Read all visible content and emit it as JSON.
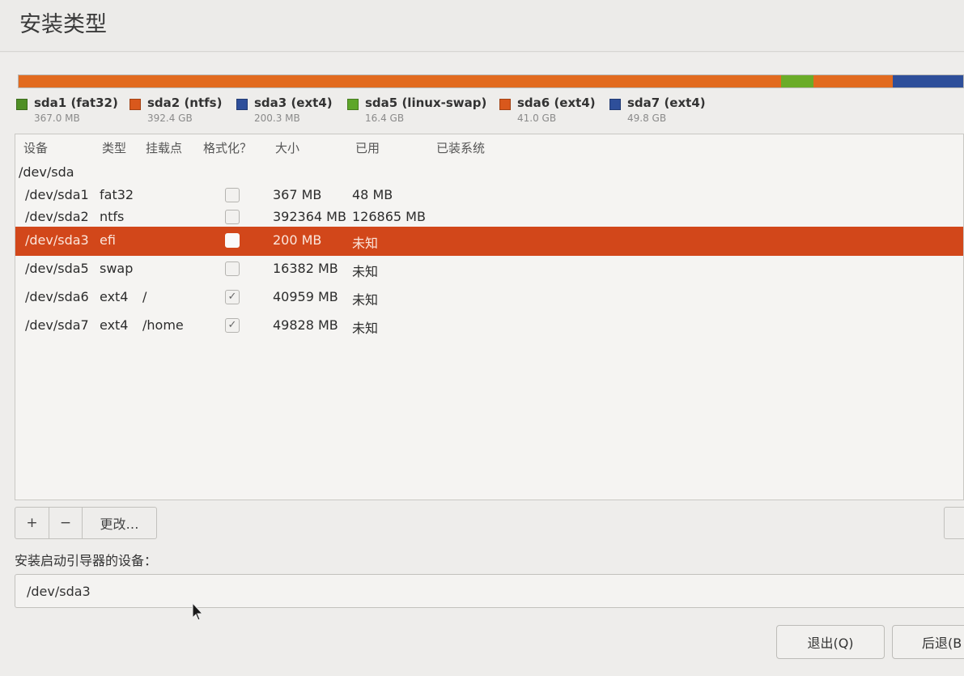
{
  "window": {
    "title": "安装类型"
  },
  "disk_bar": {
    "segments": [
      {
        "name": "sda1",
        "color": "#5d9b2a",
        "fraction": 0.0004
      },
      {
        "name": "sda2",
        "color": "#e26b1f",
        "fraction": 0.8068
      },
      {
        "name": "sda3",
        "color": "#2e4f9a",
        "fraction": 0.0004
      },
      {
        "name": "sda5",
        "color": "#6aac28",
        "fraction": 0.0337
      },
      {
        "name": "sda6",
        "color": "#e26b1f",
        "fraction": 0.0843
      },
      {
        "name": "sda7",
        "color": "#2e4f9a",
        "fraction": 0.0744
      }
    ]
  },
  "legend": [
    {
      "name": "sda1 (fat32)",
      "size": "367.0 MB",
      "color": "#4f8f25"
    },
    {
      "name": "sda2 (ntfs)",
      "size": "392.4 GB",
      "color": "#d9581c"
    },
    {
      "name": "sda3 (ext4)",
      "size": "200.3 MB",
      "color": "#2e4f9a"
    },
    {
      "name": "sda5 (linux-swap)",
      "size": "16.4 GB",
      "color": "#5ea62a"
    },
    {
      "name": "sda6 (ext4)",
      "size": "41.0 GB",
      "color": "#d9581c"
    },
    {
      "name": "sda7 (ext4)",
      "size": "49.8 GB",
      "color": "#2e4f9a"
    }
  ],
  "table": {
    "columns": [
      "设备",
      "类型",
      "挂载点",
      "格式化？",
      "大小",
      "已用",
      "已装系统"
    ],
    "disk_row": "/dev/sda",
    "rows": [
      {
        "device": "/dev/sda1",
        "type": "fat32",
        "mount": "",
        "format": false,
        "size": "367 MB",
        "used": "48 MB",
        "system": "",
        "selected": false
      },
      {
        "device": "/dev/sda2",
        "type": "ntfs",
        "mount": "",
        "format": false,
        "size": "392364 MB",
        "used": "126865 MB",
        "system": "",
        "selected": false
      },
      {
        "device": "/dev/sda3",
        "type": "efi",
        "mount": "",
        "format": false,
        "size": "200 MB",
        "used": "未知",
        "system": "",
        "selected": true
      },
      {
        "device": "/dev/sda5",
        "type": "swap",
        "mount": "",
        "format": false,
        "size": "16382 MB",
        "used": "未知",
        "system": "",
        "selected": false
      },
      {
        "device": "/dev/sda6",
        "type": "ext4",
        "mount": "/",
        "format": true,
        "size": "40959 MB",
        "used": "未知",
        "system": "",
        "selected": false
      },
      {
        "device": "/dev/sda7",
        "type": "ext4",
        "mount": "/home",
        "format": true,
        "size": "49828 MB",
        "used": "未知",
        "system": "",
        "selected": false
      }
    ]
  },
  "toolbar": {
    "add_label": "+",
    "remove_label": "−",
    "change_label": "更改…"
  },
  "bootloader": {
    "label": "安装启动引导器的设备：",
    "value": "/dev/sda3"
  },
  "buttons": {
    "quit_label": "退出(Q)",
    "back_label": "后退(B"
  },
  "icons": {
    "checkbox_checked": "check-mark",
    "cursor": "mouse-pointer-icon"
  }
}
